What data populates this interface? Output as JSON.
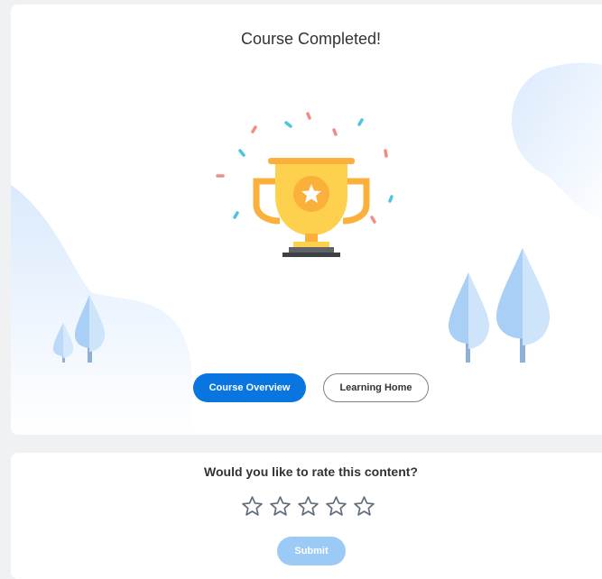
{
  "completion": {
    "title": "Course Completed!",
    "buttons": {
      "overview": "Course Overview",
      "home": "Learning Home"
    }
  },
  "rating": {
    "question": "Would you like to rate this content?",
    "stars_total": 5,
    "stars_selected": 0,
    "submit": "Submit"
  },
  "colors": {
    "primary": "#0875e1",
    "trophy": "#fdd04e",
    "submit_disabled": "#9ccaf7"
  },
  "icons": [
    "trophy-icon",
    "star-icon"
  ]
}
